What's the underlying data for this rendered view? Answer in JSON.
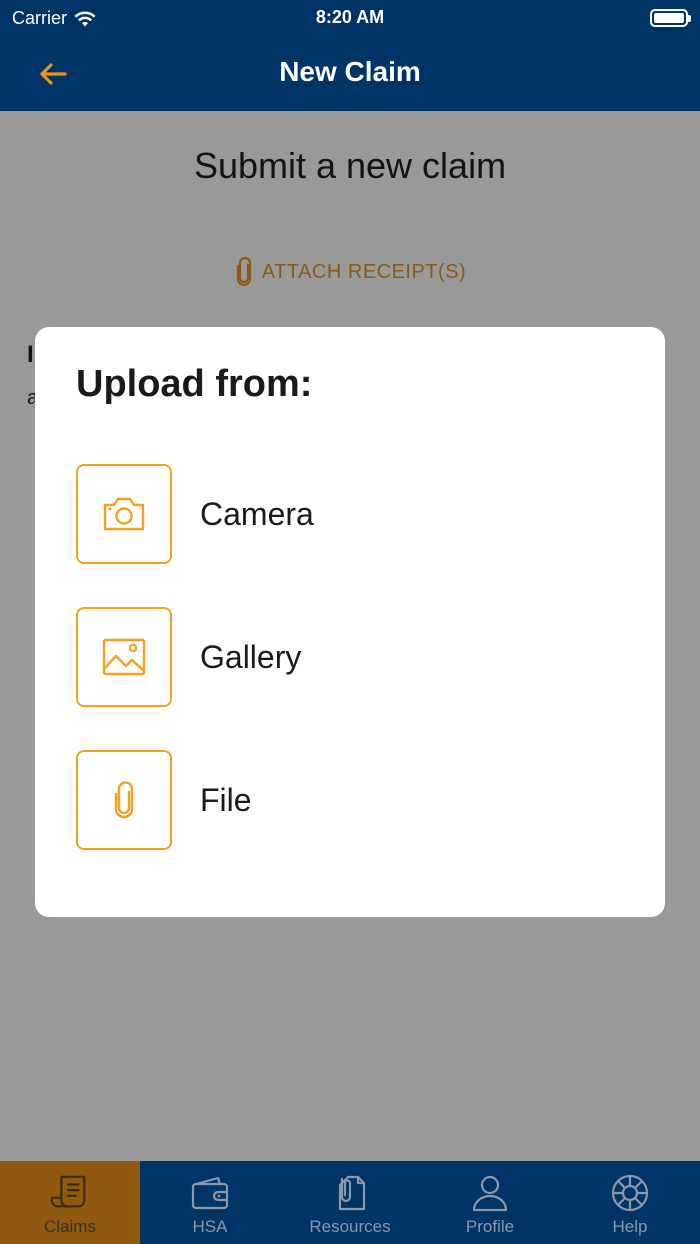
{
  "status_bar": {
    "carrier": "Carrier",
    "time": "8:20 AM"
  },
  "nav": {
    "title": "New Claim",
    "back_icon": "arrow-left-icon"
  },
  "page": {
    "heading": "Submit a new claim",
    "attach_label": "ATTACH RECEIPT(S)",
    "partially_hidden": {
      "line1": "I",
      "line2": "a"
    }
  },
  "modal": {
    "title": "Upload from:",
    "options": [
      {
        "label": "Camera",
        "icon": "camera-icon"
      },
      {
        "label": "Gallery",
        "icon": "image-icon"
      },
      {
        "label": "File",
        "icon": "paperclip-icon"
      }
    ]
  },
  "tabbar": {
    "active": "Claims",
    "items": [
      {
        "label": "Claims",
        "icon": "receipt-icon"
      },
      {
        "label": "HSA",
        "icon": "wallet-icon"
      },
      {
        "label": "Resources",
        "icon": "documents-icon"
      },
      {
        "label": "Profile",
        "icon": "person-icon"
      },
      {
        "label": "Help",
        "icon": "lifebuoy-icon"
      }
    ]
  },
  "colors": {
    "header_bg": "#003366",
    "accent": "#f5a020",
    "active_tab_bg": "#8f5a10",
    "inactive_tab": "#8c98aa"
  }
}
